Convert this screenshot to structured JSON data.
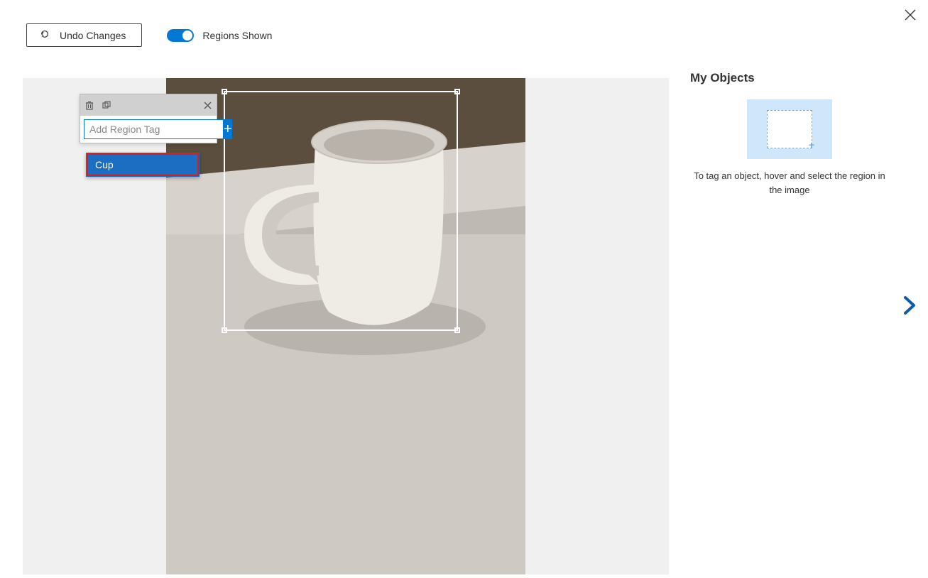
{
  "toolbar": {
    "undo_label": "Undo Changes",
    "toggle_label": "Regions Shown"
  },
  "tag_popup": {
    "input_placeholder": "Add Region Tag",
    "suggestion": "Cup"
  },
  "right_panel": {
    "title": "My Objects",
    "hint": "To tag an object, hover and select the region in the image"
  }
}
